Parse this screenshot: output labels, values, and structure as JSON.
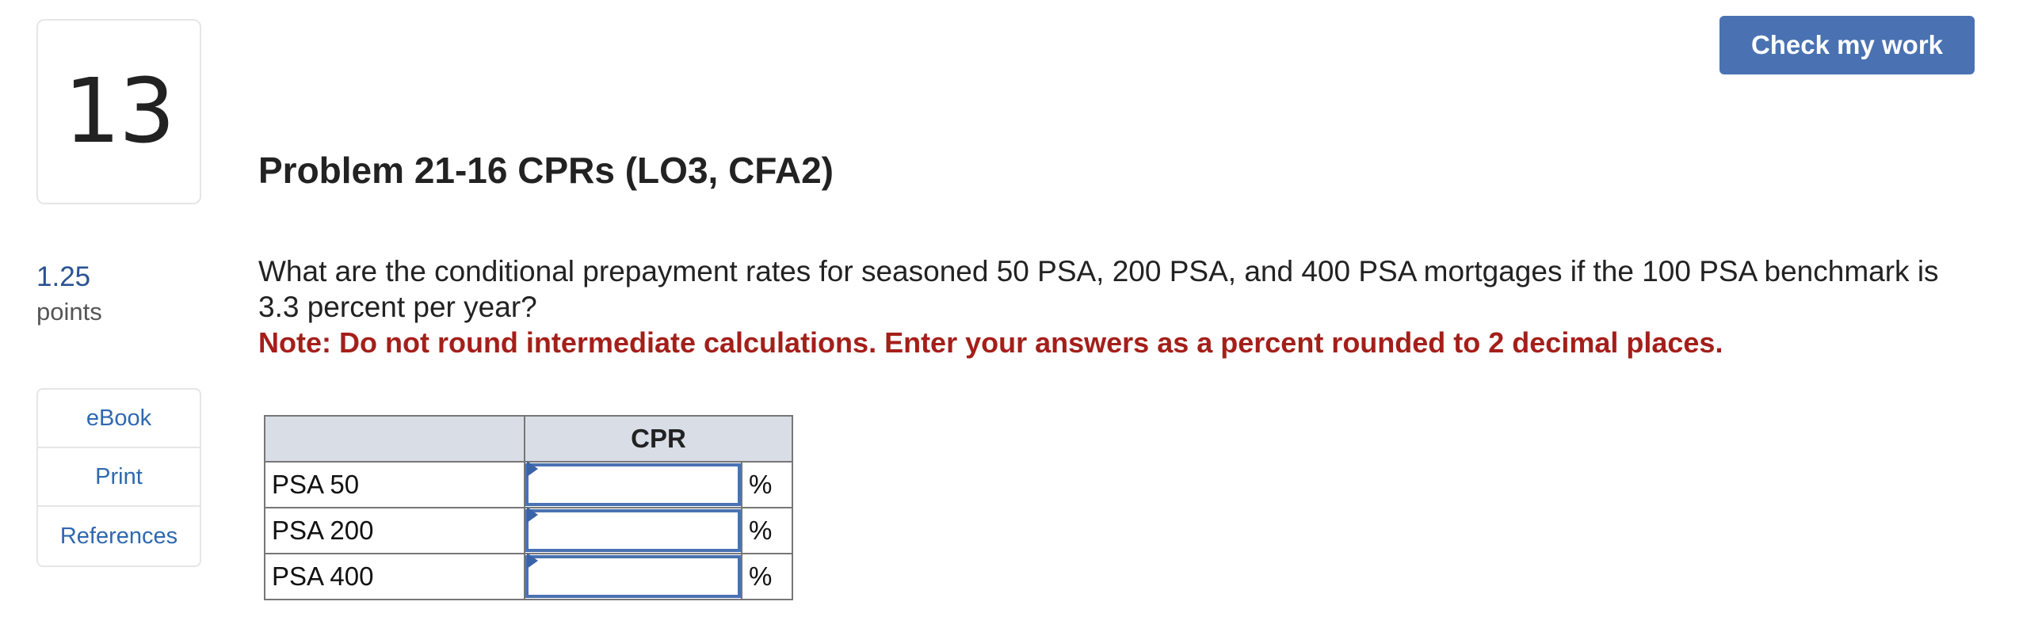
{
  "question": {
    "number": "13",
    "points_value": "1.25",
    "points_label": "points",
    "title": "Problem 21-16 CPRs (LO3, CFA2)",
    "text": "What are the conditional prepayment rates for seasoned 50 PSA, 200 PSA, and 400 PSA mortgages if the 100 PSA benchmark is 3.3 percent per year?",
    "note": "Note: Do not round intermediate calculations. Enter your answers as a percent rounded to 2 decimal places."
  },
  "header": {
    "check_button_label": "Check my work"
  },
  "sidebar": {
    "links": [
      {
        "label": "eBook"
      },
      {
        "label": "Print"
      },
      {
        "label": "References"
      }
    ]
  },
  "table": {
    "header_blank": "",
    "column_header": "CPR",
    "rows": [
      {
        "label": "PSA 50",
        "value": "",
        "unit": "%"
      },
      {
        "label": "PSA 200",
        "value": "",
        "unit": "%"
      },
      {
        "label": "PSA 400",
        "value": "",
        "unit": "%"
      }
    ]
  },
  "colors": {
    "accent": "#4a72b2",
    "link": "#2f68b0",
    "note_red": "#a41f1a",
    "table_header_bg": "#d9dde6"
  }
}
